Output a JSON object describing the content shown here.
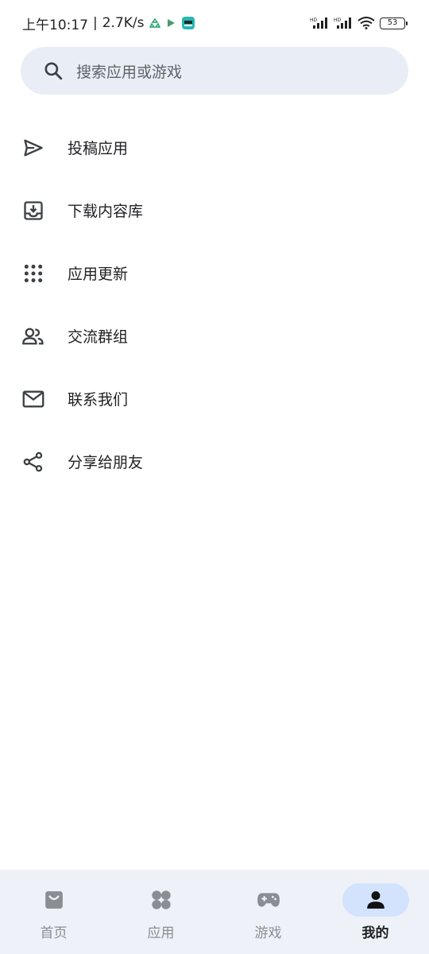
{
  "status_bar": {
    "time": "上午10:17",
    "separator": "|",
    "speed": "2.7K/s",
    "battery": "53",
    "icons": [
      "recycle-icon",
      "play-store-icon",
      "app-notification-icon",
      "hd-signal-icon",
      "hd-signal-icon",
      "wifi-icon",
      "battery-icon"
    ]
  },
  "search": {
    "placeholder": "搜索应用或游戏",
    "icon": "search-icon"
  },
  "menu": {
    "items": [
      {
        "label": "投稿应用",
        "icon": "send-icon"
      },
      {
        "label": "下载内容库",
        "icon": "download-inbox-icon"
      },
      {
        "label": "应用更新",
        "icon": "apps-grid-icon"
      },
      {
        "label": "交流群组",
        "icon": "group-icon"
      },
      {
        "label": "联系我们",
        "icon": "mail-icon"
      },
      {
        "label": "分享给朋友",
        "icon": "share-icon"
      }
    ]
  },
  "bottom_nav": {
    "items": [
      {
        "label": "首页",
        "icon": "home-bag-icon",
        "active": false
      },
      {
        "label": "应用",
        "icon": "apps-icon",
        "active": false
      },
      {
        "label": "游戏",
        "icon": "gamepad-icon",
        "active": false
      },
      {
        "label": "我的",
        "icon": "person-icon",
        "active": true
      }
    ]
  },
  "colors": {
    "search_bg": "#e9eef6",
    "nav_bg": "#eef2f8",
    "active_pill": "#d3e3fd",
    "icon_gray": "#8a8d92",
    "text_dark": "#202124"
  }
}
